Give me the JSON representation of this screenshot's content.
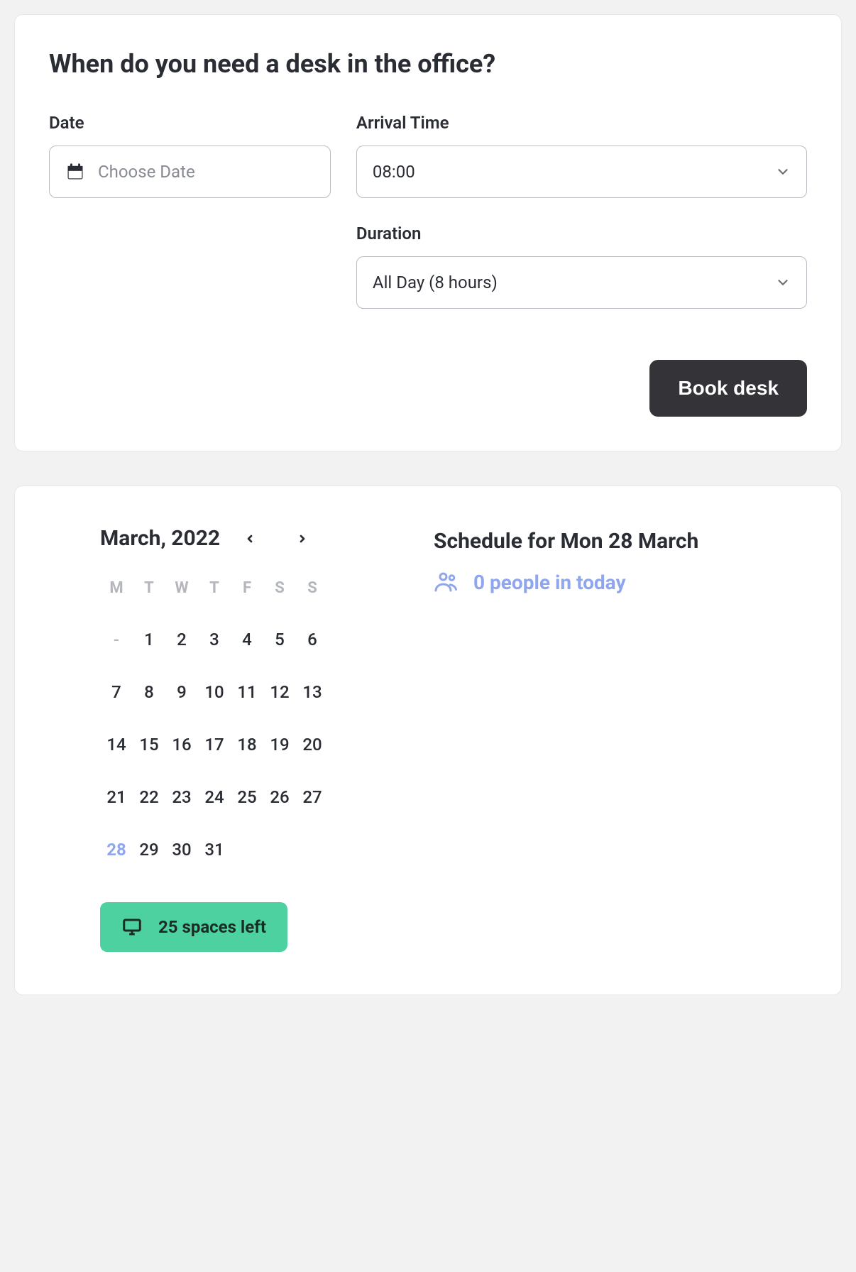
{
  "booking": {
    "title": "When do you need a desk in the office?",
    "date_label": "Date",
    "date_placeholder": "Choose Date",
    "arrival_label": "Arrival Time",
    "arrival_value": "08:00",
    "duration_label": "Duration",
    "duration_value": "All Day (8 hours)",
    "book_btn": "Book desk"
  },
  "calendar": {
    "title": "March, 2022",
    "dow": [
      "M",
      "T",
      "W",
      "T",
      "F",
      "S",
      "S"
    ],
    "weeks": [
      [
        "-",
        "1",
        "2",
        "3",
        "4",
        "5",
        "6"
      ],
      [
        "7",
        "8",
        "9",
        "10",
        "11",
        "12",
        "13"
      ],
      [
        "14",
        "15",
        "16",
        "17",
        "18",
        "19",
        "20"
      ],
      [
        "21",
        "22",
        "23",
        "24",
        "25",
        "26",
        "27"
      ],
      [
        "28",
        "29",
        "30",
        "31",
        "",
        "",
        ""
      ]
    ],
    "selected_day": "28",
    "spaces_left": "25 spaces left"
  },
  "schedule": {
    "title": "Schedule for Mon 28 March",
    "people_text": "0 people in today"
  }
}
